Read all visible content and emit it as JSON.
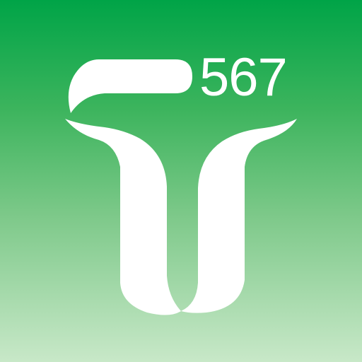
{
  "app_icon": {
    "route_number": "567",
    "mark_icon": "t-logo-icon",
    "colors": {
      "gradient_top": "#00a447",
      "gradient_bottom": "#c8e8c8",
      "foreground": "#ffffff"
    }
  }
}
